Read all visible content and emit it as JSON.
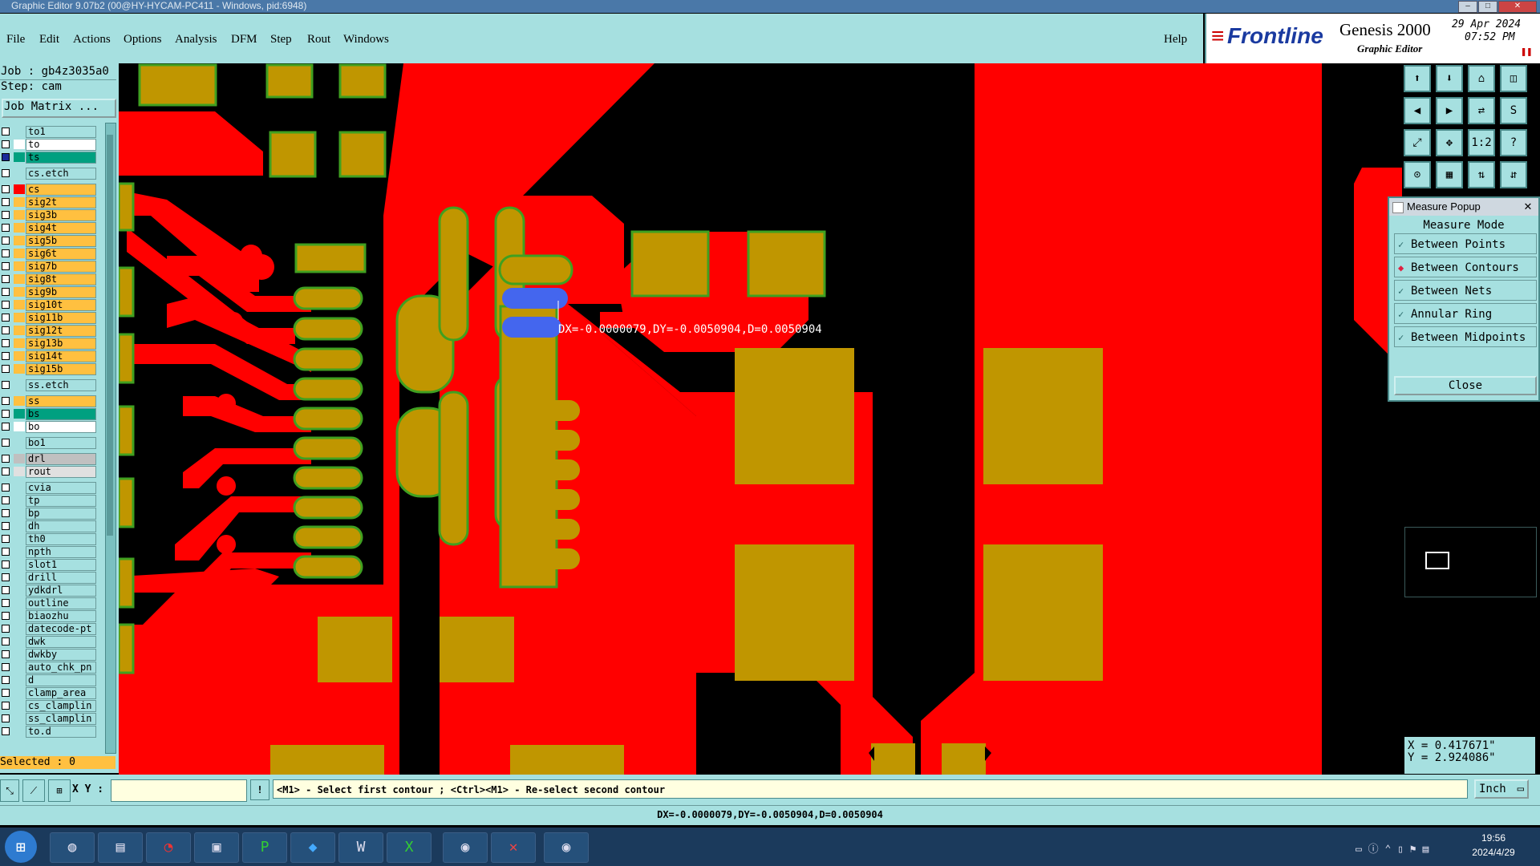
{
  "window": {
    "title": "Graphic Editor 9.07b2 (00@HY-HYCAM-PC411 - Windows, pid:6948)"
  },
  "menu": {
    "items": [
      "File",
      "Edit",
      "Actions",
      "Options",
      "Analysis",
      "DFM",
      "Step",
      "Rout",
      "Windows"
    ],
    "help": "Help"
  },
  "brand": {
    "logo": "Frontline",
    "product": "Genesis 2000",
    "subtitle": "Graphic Editor",
    "date": "29 Apr 2024",
    "time": "07:52 PM"
  },
  "job": {
    "job_label": "Job : gb4z3035a0",
    "step_label": "Step: cam",
    "matrix_button": "Job Matrix ..."
  },
  "layers": [
    {
      "name": "to1",
      "color": "#a6e0e0",
      "label_bg": "#a6e0e0"
    },
    {
      "name": "to",
      "color": "#ffffff",
      "label_bg": "#ffffff"
    },
    {
      "name": "ts",
      "color": "#00a080",
      "label_bg": "#00a080",
      "selected": true
    },
    {
      "name": "cs.etch",
      "color": "#a6e0e0",
      "label_bg": "#a6e0e0",
      "gap": true
    },
    {
      "name": "cs",
      "color": "#ff0000",
      "label_bg": "#ffc040",
      "gap": true
    },
    {
      "name": "sig2t",
      "color": "#ffc040",
      "label_bg": "#ffc040"
    },
    {
      "name": "sig3b",
      "color": "#ffc040",
      "label_bg": "#ffc040"
    },
    {
      "name": "sig4t",
      "color": "#ffc040",
      "label_bg": "#ffc040"
    },
    {
      "name": "sig5b",
      "color": "#ffc040",
      "label_bg": "#ffc040"
    },
    {
      "name": "sig6t",
      "color": "#ffc040",
      "label_bg": "#ffc040"
    },
    {
      "name": "sig7b",
      "color": "#ffc040",
      "label_bg": "#ffc040"
    },
    {
      "name": "sig8t",
      "color": "#ffc040",
      "label_bg": "#ffc040"
    },
    {
      "name": "sig9b",
      "color": "#ffc040",
      "label_bg": "#ffc040"
    },
    {
      "name": "sig10t",
      "color": "#ffc040",
      "label_bg": "#ffc040"
    },
    {
      "name": "sig11b",
      "color": "#ffc040",
      "label_bg": "#ffc040"
    },
    {
      "name": "sig12t",
      "color": "#ffc040",
      "label_bg": "#ffc040"
    },
    {
      "name": "sig13b",
      "color": "#ffc040",
      "label_bg": "#ffc040"
    },
    {
      "name": "sig14t",
      "color": "#ffc040",
      "label_bg": "#ffc040"
    },
    {
      "name": "sig15b",
      "color": "#ffc040",
      "label_bg": "#ffc040"
    },
    {
      "name": "ss.etch",
      "color": "#a6e0e0",
      "label_bg": "#a6e0e0",
      "gap": true
    },
    {
      "name": "ss",
      "color": "#ffc040",
      "label_bg": "#ffc040",
      "gap": true
    },
    {
      "name": "bs",
      "color": "#00a080",
      "label_bg": "#00a080"
    },
    {
      "name": "bo",
      "color": "#ffffff",
      "label_bg": "#ffffff"
    },
    {
      "name": "bo1",
      "color": "#a6e0e0",
      "label_bg": "#a6e0e0",
      "gap": true
    },
    {
      "name": "drl",
      "color": "#c0c0c0",
      "label_bg": "#c0c0c0",
      "gap": true
    },
    {
      "name": "rout",
      "color": "#e0e0e0",
      "label_bg": "#e0e0e0"
    },
    {
      "name": "cvia",
      "color": "#a6e0e0",
      "label_bg": "#a6e0e0",
      "gap": true
    },
    {
      "name": "tp",
      "color": "#a6e0e0",
      "label_bg": "#a6e0e0"
    },
    {
      "name": "bp",
      "color": "#a6e0e0",
      "label_bg": "#a6e0e0"
    },
    {
      "name": "dh",
      "color": "#a6e0e0",
      "label_bg": "#a6e0e0"
    },
    {
      "name": "th0",
      "color": "#a6e0e0",
      "label_bg": "#a6e0e0"
    },
    {
      "name": "npth",
      "color": "#a6e0e0",
      "label_bg": "#a6e0e0"
    },
    {
      "name": "slot1",
      "color": "#a6e0e0",
      "label_bg": "#a6e0e0"
    },
    {
      "name": "drill",
      "color": "#a6e0e0",
      "label_bg": "#a6e0e0"
    },
    {
      "name": "ydkdrl",
      "color": "#a6e0e0",
      "label_bg": "#a6e0e0"
    },
    {
      "name": "outline",
      "color": "#a6e0e0",
      "label_bg": "#a6e0e0"
    },
    {
      "name": "biaozhu",
      "color": "#a6e0e0",
      "label_bg": "#a6e0e0"
    },
    {
      "name": "datecode-pt",
      "color": "#a6e0e0",
      "label_bg": "#a6e0e0"
    },
    {
      "name": "dwk",
      "color": "#a6e0e0",
      "label_bg": "#a6e0e0"
    },
    {
      "name": "dwkby",
      "color": "#a6e0e0",
      "label_bg": "#a6e0e0"
    },
    {
      "name": "auto_chk_pn",
      "color": "#a6e0e0",
      "label_bg": "#a6e0e0"
    },
    {
      "name": "d",
      "color": "#a6e0e0",
      "label_bg": "#a6e0e0"
    },
    {
      "name": "clamp_area",
      "color": "#a6e0e0",
      "label_bg": "#a6e0e0"
    },
    {
      "name": "cs_clamplin",
      "color": "#a6e0e0",
      "label_bg": "#a6e0e0"
    },
    {
      "name": "ss_clamplin",
      "color": "#a6e0e0",
      "label_bg": "#a6e0e0"
    },
    {
      "name": "to.d",
      "color": "#a6e0e0",
      "label_bg": "#a6e0e0"
    }
  ],
  "selected_label": "Selected : 0",
  "canvas": {
    "measure_text": "DX=-0.0000079,DY=-0.0050904,D=0.0050904"
  },
  "toolbar_icons": [
    "zoom-home-icon",
    "zoom-back-icon",
    "home-icon",
    "window-icon",
    "pan-left-icon",
    "pan-right-icon",
    "flip-icon",
    "snap-icon",
    "fit-icon",
    "center-icon",
    "scale-1-2-icon",
    "help-icon",
    "measure-icon",
    "grid-icon",
    "layers-up-icon",
    "layers-down-icon"
  ],
  "toolbar_glyphs": [
    "⬆",
    "⬇",
    "⌂",
    "◫",
    "◀",
    "▶",
    "⇄",
    "S",
    "⤢",
    "✥",
    "1:2",
    "?",
    "⊙",
    "▦",
    "⇅",
    "⇵"
  ],
  "measure_popup": {
    "title": "Measure Popup",
    "heading": "Measure Mode",
    "modes": [
      "Between Points",
      "Between Contours",
      "Between Nets",
      "Annular Ring",
      "Between Midpoints"
    ],
    "selected_mode": "Between Contours",
    "close_label": "Close"
  },
  "coords": {
    "x": "X = 0.417671\"",
    "y": "Y = 2.924086\""
  },
  "command": {
    "xy_label": "X Y :",
    "xy_value": "",
    "prompt": "<M1> - Select first contour ; <Ctrl><M1> - Re-select second contour",
    "units": "Inch"
  },
  "status": {
    "text": "DX=-0.0000079,DY=-0.0050904,D=0.0050904"
  },
  "taskbar": {
    "time": "19:56",
    "date": "2024/4/29"
  },
  "colors": {
    "copper": "#ff0000",
    "pad": "#c09600",
    "mask": "#40a020",
    "highlight": "#4466ee",
    "panel": "#a6e0e0"
  }
}
